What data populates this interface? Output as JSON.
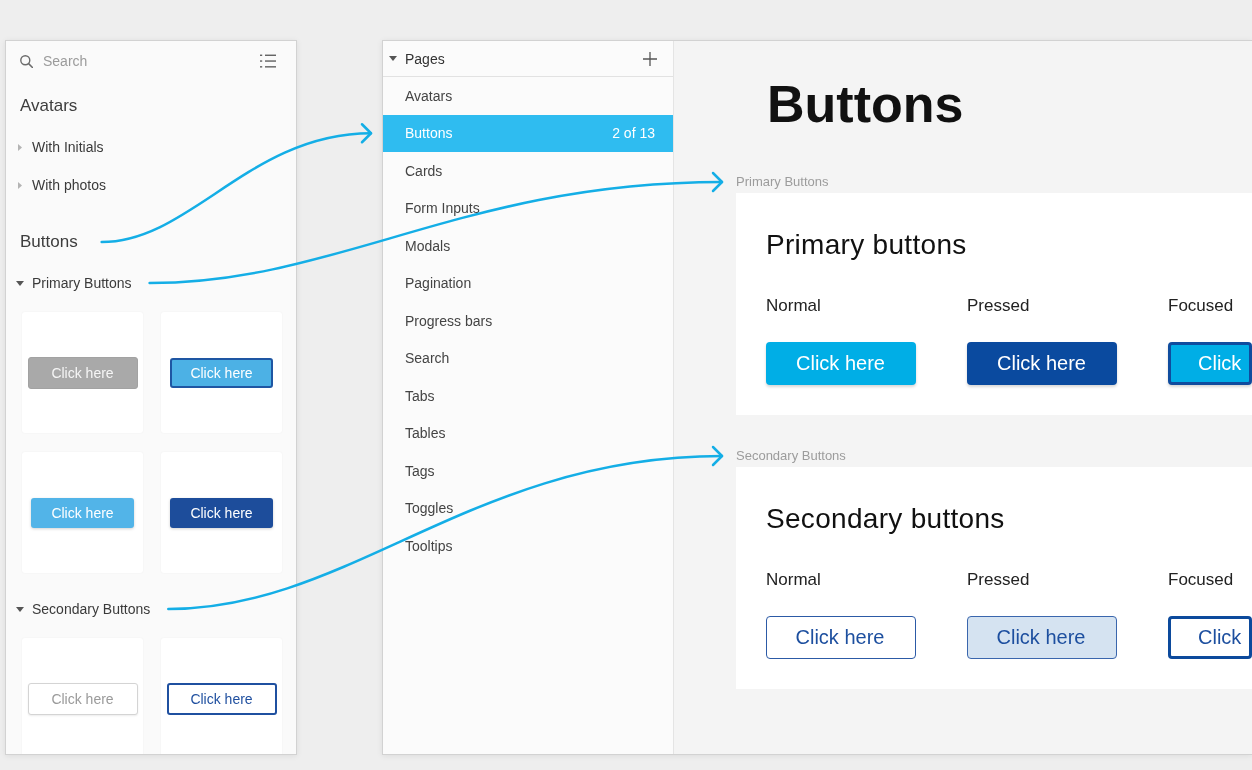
{
  "library": {
    "search": {
      "placeholder": "Search"
    },
    "groups": [
      {
        "title": "Avatars",
        "children": [
          {
            "label": "With Initials",
            "expanded": false
          },
          {
            "label": "With photos",
            "expanded": false
          }
        ]
      },
      {
        "title": "Buttons",
        "children": [
          {
            "label": "Primary Buttons",
            "expanded": true,
            "kind": "primary",
            "thumbnails": [
              {
                "label": "Click here",
                "disabled": true,
                "pressed": false,
                "focused": false
              },
              {
                "label": "Click here",
                "disabled": false,
                "pressed": false,
                "focused": true
              },
              {
                "label": "Click here",
                "disabled": false,
                "pressed": false,
                "focused": false
              },
              {
                "label": "Click here",
                "disabled": false,
                "pressed": true,
                "focused": false
              }
            ]
          },
          {
            "label": "Secondary Buttons",
            "expanded": true,
            "kind": "secondary",
            "thumbnails": [
              {
                "label": "Click here",
                "disabled": true,
                "pressed": false,
                "focused": false
              },
              {
                "label": "Click here",
                "disabled": false,
                "pressed": false,
                "focused": true
              }
            ]
          }
        ]
      }
    ]
  },
  "pages": {
    "title": "Pages",
    "expanded": true,
    "items": [
      {
        "label": "Avatars",
        "selected": false
      },
      {
        "label": "Buttons",
        "selected": true,
        "counter": "2 of 13"
      },
      {
        "label": "Cards",
        "selected": false
      },
      {
        "label": "Form Inputs",
        "selected": false
      },
      {
        "label": "Modals",
        "selected": false
      },
      {
        "label": "Pagination",
        "selected": false
      },
      {
        "label": "Progress bars",
        "selected": false
      },
      {
        "label": "Search",
        "selected": false
      },
      {
        "label": "Tabs",
        "selected": false
      },
      {
        "label": "Tables",
        "selected": false
      },
      {
        "label": "Tags",
        "selected": false
      },
      {
        "label": "Toggles",
        "selected": false
      },
      {
        "label": "Tooltips",
        "selected": false
      }
    ]
  },
  "canvas": {
    "title": "Buttons",
    "sections": [
      {
        "label": "Primary Buttons",
        "title": "Primary buttons",
        "kind": "primary",
        "states": [
          {
            "label": "Normal",
            "button": "Click here",
            "pressed": false,
            "focused": false
          },
          {
            "label": "Pressed",
            "button": "Click here",
            "pressed": true,
            "focused": false
          },
          {
            "label": "Focused",
            "button": "Click",
            "pressed": false,
            "focused": true
          }
        ]
      },
      {
        "label": "Secondary Buttons",
        "title": "Secondary buttons",
        "kind": "secondary",
        "states": [
          {
            "label": "Normal",
            "button": "Click here",
            "pressed": false,
            "focused": false
          },
          {
            "label": "Pressed",
            "button": "Click here",
            "pressed": true,
            "focused": false
          },
          {
            "label": "Focused",
            "button": "Click",
            "pressed": false,
            "focused": true
          }
        ]
      }
    ]
  }
}
